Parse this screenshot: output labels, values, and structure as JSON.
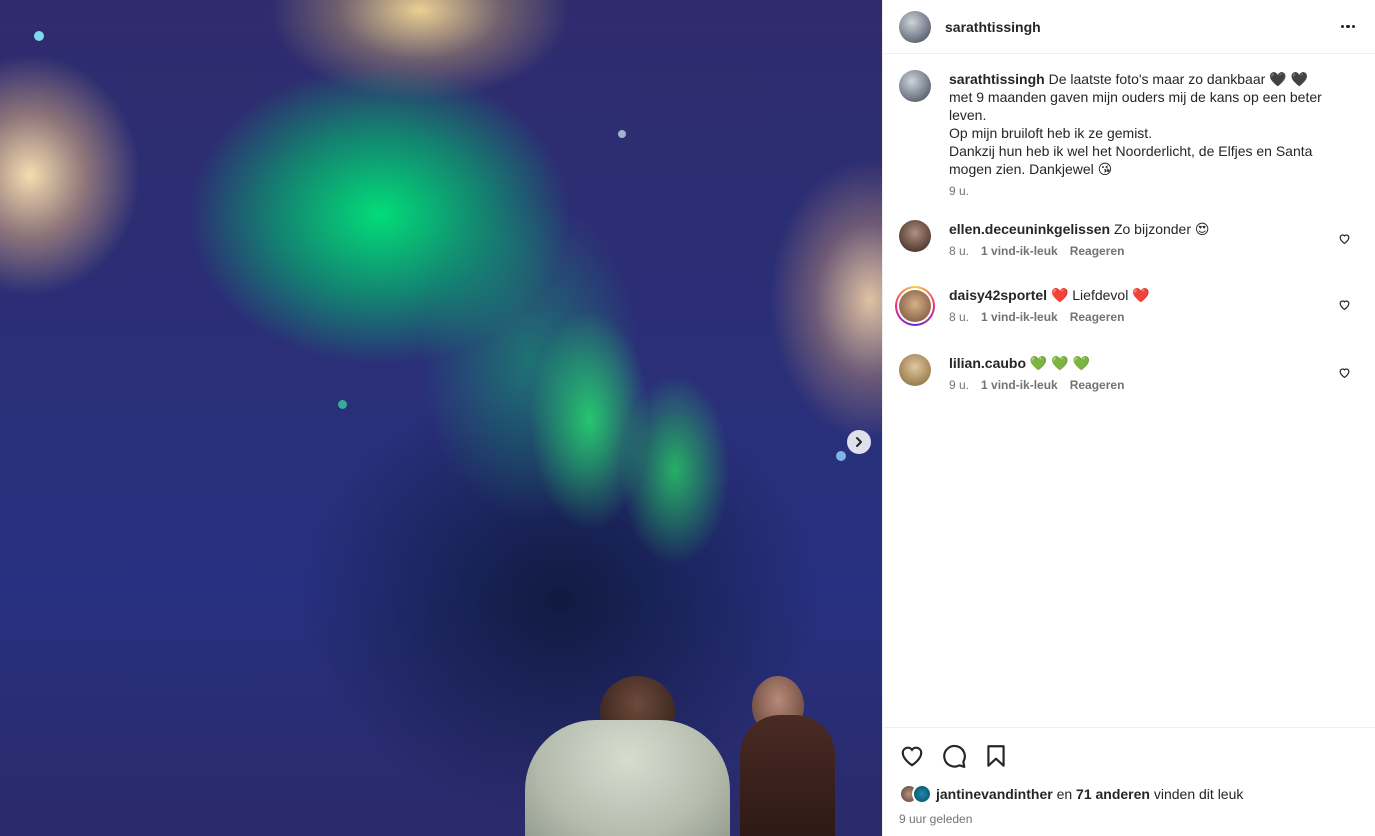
{
  "post": {
    "author": "sarathtissingh",
    "caption_lines": [
      "De laatste foto's maar zo dankbaar 🖤 🖤",
      "met 9 maanden gaven mijn ouders mij de kans op een beter",
      "leven.",
      "Op mijn bruiloft heb ik ze gemist.",
      "Dankzij hun heb ik wel het Noorderlicht, de Elfjes en Santa",
      "mogen zien. Dankjewel 😘"
    ],
    "caption_time": "9 u."
  },
  "comments": [
    {
      "user": "ellen.deceuninkgelissen",
      "text": "Zo bijzonder 😍",
      "time": "8 u.",
      "likes": "1 vind-ik-leuk",
      "reply": "Reageren"
    },
    {
      "user": "daisy42sportel",
      "text": "❤️ Liefdevol ❤️",
      "time": "8 u.",
      "likes": "1 vind-ik-leuk",
      "reply": "Reageren"
    },
    {
      "user": "lilian.caubo",
      "text": "💚 💚 💚",
      "time": "9 u.",
      "likes": "1 vind-ik-leuk",
      "reply": "Reageren"
    }
  ],
  "footer": {
    "liker": "jantinevandinther",
    "and": "en",
    "others": "71 anderen",
    "suffix": "vinden dit leuk",
    "posted": "9 uur geleden"
  },
  "icons": {
    "like": "heart-icon",
    "comment": "comment-icon",
    "save": "bookmark-icon",
    "more": "more-options-icon",
    "next": "chevron-right-icon"
  },
  "colors": {
    "text": "#262626",
    "secondary": "#737373",
    "divider": "#efefef"
  }
}
